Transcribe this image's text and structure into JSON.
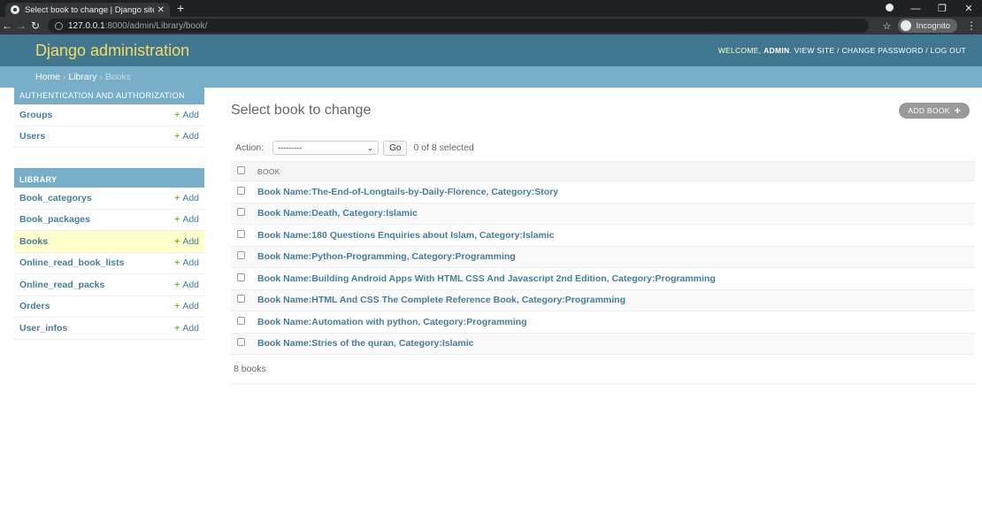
{
  "browser": {
    "tab_title": "Select book to change | Django site admin",
    "url_host": "127.0.0.1",
    "url_rest": ":8000/admin/Library/book/",
    "incognito_label": "Incognito"
  },
  "header": {
    "branding": "Django administration",
    "welcome": "Welcome,",
    "username": "admin",
    "view_site": "View site",
    "change_password": "Change password",
    "log_out": "Log out"
  },
  "breadcrumbs": {
    "home": "Home",
    "app": "Library",
    "current": "Books"
  },
  "sidebar": {
    "auth": {
      "caption": "Authentication and Authorization",
      "models": [
        {
          "name": "Groups",
          "add": "Add"
        },
        {
          "name": "Users",
          "add": "Add"
        }
      ]
    },
    "library": {
      "caption": "Library",
      "models": [
        {
          "name": "Book_categorys",
          "add": "Add"
        },
        {
          "name": "Book_packages",
          "add": "Add"
        },
        {
          "name": "Books",
          "add": "Add"
        },
        {
          "name": "Online_read_book_lists",
          "add": "Add"
        },
        {
          "name": "Online_read_packs",
          "add": "Add"
        },
        {
          "name": "Orders",
          "add": "Add"
        },
        {
          "name": "User_infos",
          "add": "Add"
        }
      ]
    }
  },
  "content": {
    "title": "Select book to change",
    "add_button": "Add book",
    "action_label": "Action:",
    "action_selected": "---------",
    "go_label": "Go",
    "selection_count": "0 of 8 selected",
    "column_header": "Book",
    "rows": [
      "Book Name:The-End-of-Longtails-by-Daily-Florence, Category:Story",
      "Book Name:Death, Category:Islamic",
      "Book Name:180 Questions Enquiries about Islam, Category:Islamic",
      "Book Name:Python-Programming, Category:Programming",
      "Book Name:Building Android Apps With HTML CSS And Javascript 2nd Edition, Category:Programming",
      "Book Name:HTML And CSS The Complete Reference Book, Category:Programming",
      "Book Name:Automation with python, Category:Programming",
      "Book Name:Stries of the quran, Category:Islamic"
    ],
    "paginator": "8 books"
  }
}
